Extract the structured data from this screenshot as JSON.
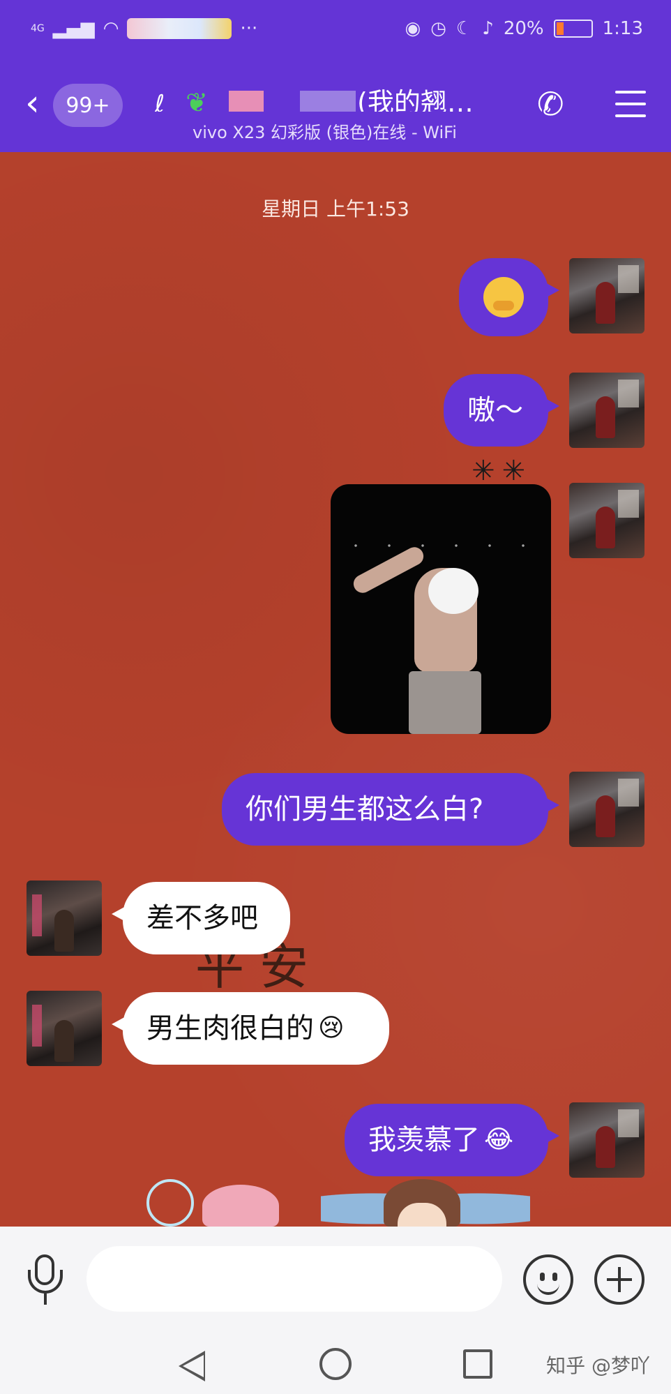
{
  "status_bar": {
    "network": "4G",
    "battery_percent": "20%",
    "time": "1:13",
    "colors": {
      "battery_fill": "#ff7a2d"
    }
  },
  "header": {
    "back_icon": "chevron-left-icon",
    "unread_badge": "99+",
    "title_suffix": "(我的翘…",
    "subtitle": "vivo X23 幻彩版 (银色)在线 - WiFi",
    "call_icon": "phone-icon",
    "menu_icon": "hamburger-menu-icon",
    "background": "#6434d6"
  },
  "chat": {
    "timestamp": "星期日 上午1:53",
    "messages": [
      {
        "side": "me",
        "type": "emoji",
        "emoji": "hugging-face"
      },
      {
        "side": "me",
        "type": "text",
        "text": "嗷～"
      },
      {
        "side": "me",
        "type": "image",
        "content": "photo"
      },
      {
        "side": "me",
        "type": "text",
        "text": "你们男生都这么白?"
      },
      {
        "side": "them",
        "type": "text",
        "text": "差不多吧"
      },
      {
        "side": "them",
        "type": "text",
        "text": "男生肉很白的",
        "trailing_emoji": "crying-face"
      },
      {
        "side": "me",
        "type": "text",
        "text": "我羡慕了",
        "trailing_emoji": "laughing-tears-face"
      }
    ],
    "background_decoration": "平安",
    "colors": {
      "my_bubble": "#6634d6",
      "their_bubble": "#ffffff",
      "chat_bg": "#b5412c"
    }
  },
  "input_bar": {
    "placeholder": "",
    "voice_icon": "microphone-icon",
    "emoji_icon": "smiley-icon",
    "more_icon": "plus-circle-icon"
  },
  "nav_bar": {
    "watermark": "知乎 @梦吖"
  }
}
